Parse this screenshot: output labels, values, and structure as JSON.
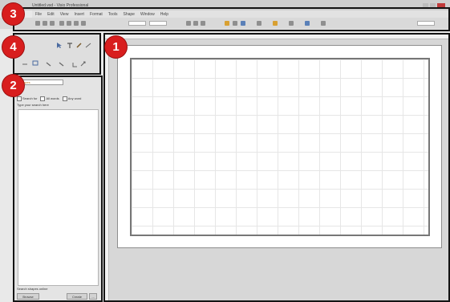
{
  "window": {
    "title": "Untitled.vsd - Visio Professional"
  },
  "menu": [
    "File",
    "Edit",
    "View",
    "Insert",
    "Format",
    "Tools",
    "Shape",
    "Window",
    "Help"
  ],
  "panel": {
    "selector_value": "Shapes",
    "options": [
      "Search for",
      "All words",
      "Any word"
    ],
    "caption": "Type your search here",
    "footer": "Search shapes online",
    "buttons": [
      "Browse",
      "Create",
      "..."
    ]
  },
  "badges": [
    "1",
    "2",
    "3",
    "4"
  ],
  "colors": {
    "badge": "#d81e1e",
    "frame": "#141414",
    "grid": "#e6e6e6"
  },
  "icons": [
    "pointer-tool-icon",
    "text-tool-icon",
    "pencil-tool-icon",
    "connector-tool-icon",
    "rectangle-tool-icon",
    "line-tool-icon",
    "freeform-tool-icon",
    "arc-tool-icon",
    "ellipse-tool-icon"
  ]
}
